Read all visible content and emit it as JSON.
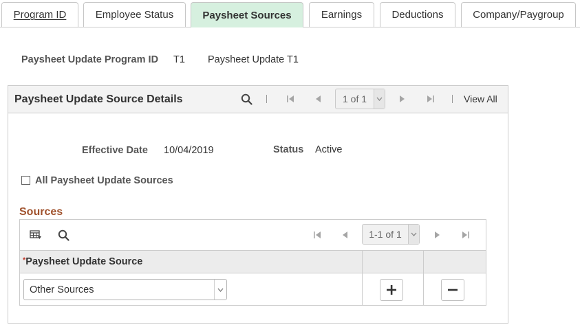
{
  "tabs": [
    {
      "label": "Program ID"
    },
    {
      "label": "Employee Status"
    },
    {
      "label": "Paysheet Sources"
    },
    {
      "label": "Earnings"
    },
    {
      "label": "Deductions"
    },
    {
      "label": "Company/Paygroup"
    }
  ],
  "active_tab": "Paysheet Sources",
  "header": {
    "program_id_label": "Paysheet Update Program ID",
    "program_id_value": "T1",
    "program_desc": "Paysheet Update T1"
  },
  "details": {
    "title": "Paysheet Update Source Details",
    "pager": "1 of 1",
    "view_all": "View All",
    "effective_date_label": "Effective Date",
    "effective_date_value": "10/04/2019",
    "status_label": "Status",
    "status_value": "Active",
    "all_sources_label": "All Paysheet Update Sources",
    "all_sources_checked": false
  },
  "sources": {
    "title": "Sources",
    "pager": "1-1 of 1",
    "column_header": "Paysheet Update Source",
    "required_marker": "*",
    "rows": [
      {
        "source": "Other Sources"
      }
    ]
  },
  "colors": {
    "active_tab_bg": "#d6f0df",
    "section_title": "#a0522d",
    "header_bg": "#f3f3f3"
  }
}
